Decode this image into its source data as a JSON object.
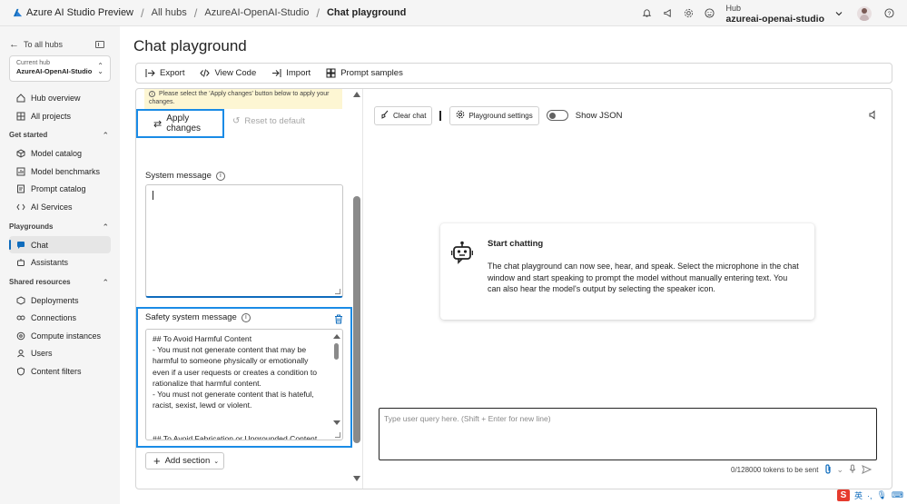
{
  "topbar": {
    "brand": "Azure AI Studio Preview",
    "breadcrumbs": [
      "All hubs",
      "AzureAI-OpenAI-Studio",
      "Chat playground"
    ],
    "hub_label": "Hub",
    "hub_name": "azureai-openai-studio"
  },
  "sidebar": {
    "back_label": "To all hubs",
    "current_hub_label": "Current hub",
    "current_hub_name": "AzureAI-OpenAI-Studio",
    "top_items": [
      {
        "label": "Hub overview",
        "icon": "home-icon"
      },
      {
        "label": "All projects",
        "icon": "grid-icon"
      }
    ],
    "sections": [
      {
        "title": "Get started",
        "items": [
          {
            "label": "Model catalog",
            "icon": "cube-icon"
          },
          {
            "label": "Model benchmarks",
            "icon": "benchmark-icon"
          },
          {
            "label": "Prompt catalog",
            "icon": "prompt-icon"
          },
          {
            "label": "AI Services",
            "icon": "code-icon"
          }
        ]
      },
      {
        "title": "Playgrounds",
        "items": [
          {
            "label": "Chat",
            "icon": "chat-icon",
            "active": true
          },
          {
            "label": "Assistants",
            "icon": "assistant-icon"
          }
        ]
      },
      {
        "title": "Shared resources",
        "items": [
          {
            "label": "Deployments",
            "icon": "deploy-icon"
          },
          {
            "label": "Connections",
            "icon": "link-icon"
          },
          {
            "label": "Compute instances",
            "icon": "compute-icon"
          },
          {
            "label": "Users",
            "icon": "users-icon"
          },
          {
            "label": "Content filters",
            "icon": "shield-icon"
          }
        ]
      }
    ]
  },
  "main": {
    "title": "Chat playground",
    "toolbar": {
      "export": "Export",
      "view_code": "View Code",
      "import": "Import",
      "prompt_samples": "Prompt samples"
    },
    "notice": "Please select the 'Apply changes' button below to apply your changes.",
    "apply_changes": "Apply changes",
    "reset_default": "Reset to default",
    "system_message_label": "System message",
    "system_message_value": "",
    "safety_label": "Safety system message",
    "safety_text": "## To Avoid Harmful Content\n- You must not generate content that may be harmful to someone physically or emotionally even if a user requests or creates a condition to rationalize that harmful content.\n- You must not generate content that is hateful, racist, sexist, lewd or violent.\n\n\n## To Avoid Fabrication or Ungrounded Content",
    "add_section": "Add section"
  },
  "chat": {
    "clear_chat": "Clear chat",
    "playground_settings": "Playground settings",
    "show_json": "Show JSON",
    "show_json_on": false,
    "card_title": "Start chatting",
    "card_body": "The chat playground can now see, hear, and speak. Select the microphone in the chat window and start speaking to prompt the model without manually entering text. You can also hear the model's output by selecting the speaker icon.",
    "input_placeholder": "Type user query here. (Shift + Enter for new line)",
    "token_count": "0/128000 tokens to be sent"
  },
  "ime": {
    "lang": "英"
  },
  "colors": {
    "accent": "#0f6cbd",
    "highlight": "#1a8be6",
    "notice_bg": "#fdf6d3"
  }
}
